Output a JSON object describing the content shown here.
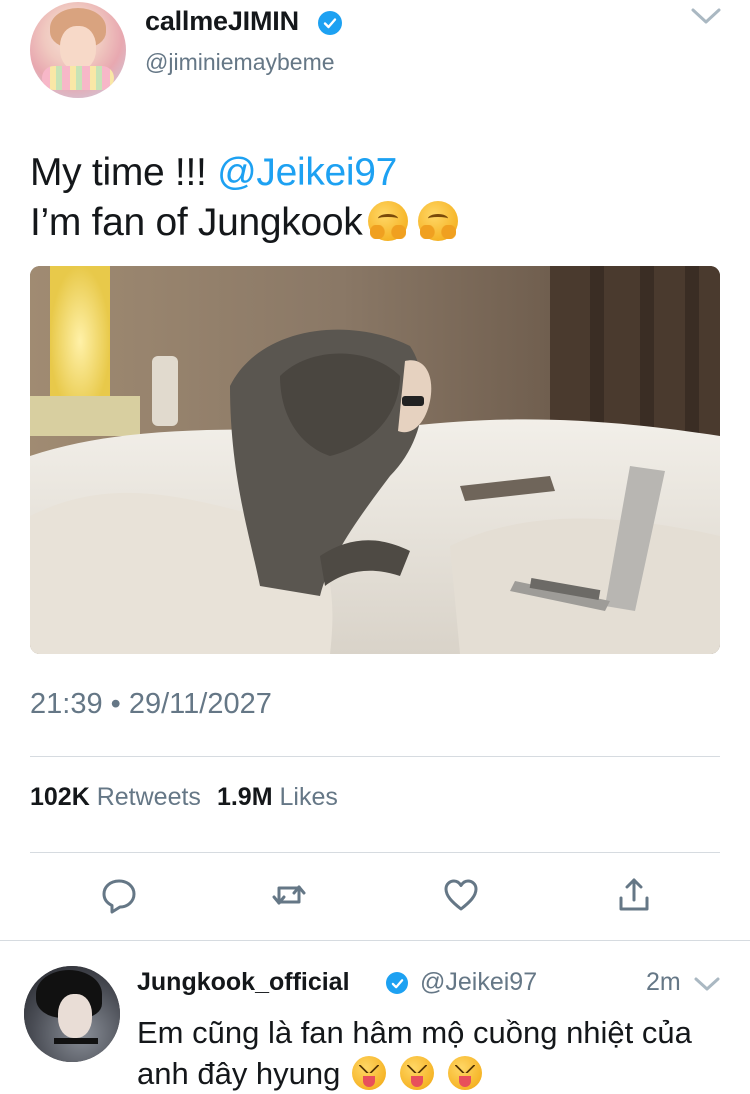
{
  "tweet": {
    "author": {
      "display_name": "callmeJIMIN",
      "handle": "@jiminiemaybeme",
      "verified": true
    },
    "text": {
      "line1_prefix": "My time !!! ",
      "mention": "@Jeikei97",
      "line2": "I’m fan of Jungkook",
      "line2_emoji": [
        "hugging-face-emoji",
        "hugging-face-emoji"
      ]
    },
    "timestamp": "21:39 • 29/11/2027",
    "stats": {
      "retweets_count": "102K",
      "retweets_label": "Retweets",
      "likes_count": "1.9M",
      "likes_label": "Likes"
    },
    "actions": [
      "reply-icon",
      "retweet-icon",
      "like-icon",
      "share-icon"
    ]
  },
  "reply": {
    "display_name": "Jungkook_official",
    "handle": "@Jeikei97",
    "verified": true,
    "time": "2m",
    "line1": "Em cũng là fan hâm mộ cuồng nhiệt của",
    "line2": "anh đây hyung",
    "emoji": [
      "squinting-tongue-emoji",
      "squinting-tongue-emoji",
      "squinting-tongue-emoji"
    ]
  },
  "colors": {
    "accent": "#1da1f2",
    "text_primary": "#14171a",
    "text_secondary": "#657786",
    "divider": "#d6dbe0"
  }
}
